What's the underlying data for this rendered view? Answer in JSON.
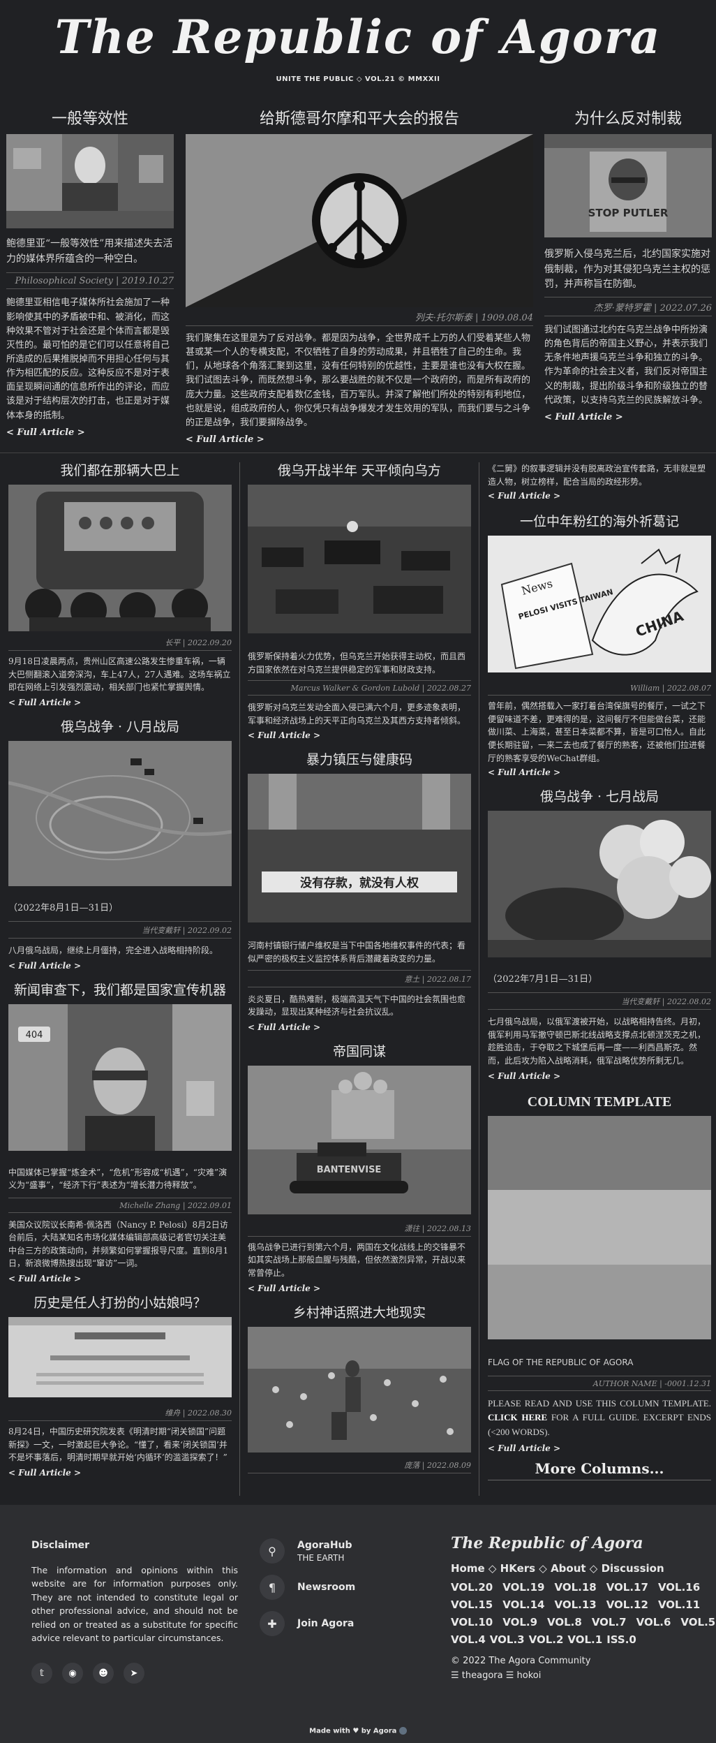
{
  "masthead": {
    "title": "The Republic of Agora",
    "issue_line": "UNITE THE PUBLIC ◇ VOL.21 © MMXXII"
  },
  "top_row": {
    "left": {
      "title": "一般等效性",
      "caption": "鲍德里亚“一般等效性”用来描述失去活力的媒体界所蕴含的一种空白。",
      "meta": "Philosophical Society | 2019.10.27",
      "body": "鲍德里亚相信电子媒体所社会施加了一种影响使其中的矛盾被中和、被消化，而这种效果不管对于社会还是个体而言都是毁灭性的。最可怕的是它们可以任意将自己所造成的后果推脱掉而不用担心任何与其作为相匹配的反应。这种反应不是对于表面呈现瞬间通的信息所作出的评论，而应该是对于结构层次的打击，也正是对于媒体本身的抵制。",
      "more": "Full Article"
    },
    "center": {
      "title": "给斯德哥尔摩和平大会的报告",
      "meta": "列夫·托尔斯泰 | 1909.08.04",
      "body": "我们聚集在这里是为了反对战争。都是因为战争，全世界成千上万的人们受着某些人物甚或某一个人的专横支配，不仅牺牲了自身的劳动成果，并且牺牲了自己的生命。我们，从地球各个角落汇聚到这里，没有任何特别的优越性，主要是谁也没有大权在握。我们试图去斗争，而既然想斗争，那么要战胜的就不仅是一个政府的，而是所有政府的庞大力量。这些政府支配着数亿金钱，百万军队。并深了解他们所处的特别有利地位，也就是说，组成政府的人，你仅凭只有战争爆发才发生效用的军队，而我们要与之斗争的正是战争，我们要摒除战争。",
      "more": "Full Article"
    },
    "right": {
      "title": "为什么反对制裁",
      "caption": "俄罗斯入侵乌克兰后，北约国家实施对俄制裁，作为对其侵犯乌克兰主权的惩罚，并声称旨在防御。",
      "meta": "杰罗·蒙特罗霍 | 2022.07.26",
      "body": "我们试图通过北约在乌克兰战争中所扮演的角色背后的帝国主义野心，并表示我们无条件地声援乌克兰斗争和独立的斗争。作为革命的社会主义者，我们反对帝国主义的制裁，提出阶级斗争和阶级独立的替代政策，以支持乌克兰的民族解放斗争。",
      "more": "Full Article"
    }
  },
  "col1": [
    {
      "title": "我们都在那辆大巴上",
      "meta": "长平 | 2022.09.20",
      "body": "9月18日凌晨两点，贵州山区高速公路发生惨重车祸，一辆大巴侧翻滚入道旁深沟，车上47人，27人遇难。这场车祸立即在网络上引发强烈震动，相关部门也紧忙掌握舆情。",
      "more": "Full Article"
    },
    {
      "title": "俄乌战争 · 八月战局",
      "caption": "（2022年8月1日—31日）",
      "meta": "当代变戴轩 | 2022.09.02",
      "body": "八月俄乌战局，继续上月僵持，完全进入战略相持阶段。",
      "more": "Full Article"
    },
    {
      "title": "新闻审查下，我们都是国家宣传机器",
      "caption": "中国媒体已掌握“炼金术”，“危机”形容成“机遇”，“灾难”演义为“盛事”，“经济下行”表述为“增长潜力待释放”。",
      "meta": "Michelle Zhang | 2022.09.01",
      "body": "美国众议院议长南希·佩洛西（Nancy P. Pelosi）8月2日访台前后，大陆某知名市场化媒体编辑部高级记者官切关注美中台三方的政策动向，并频繁如何掌握报导尺度。直到8月1日，新浪微博热搜出现“窜访”一词。",
      "more": "Full Article"
    },
    {
      "title": "历史是任人打扮的小姑娘吗？",
      "meta": "维舟 | 2022.08.30",
      "body": "8月24日，中国历史研究院发表《明清时期“闭关锁国”问题新探》一文，一时激起巨大争论。“懂了，看来‘闭关锁国’并不是坏事落后，明清时期早就开始‘内循环’的滥滥探索了！”",
      "more": "Full Article"
    }
  ],
  "col2": [
    {
      "title": "俄乌开战半年 天平倾向乌方",
      "caption": "俄罗斯保持着火力优势，但乌克兰开始获得主动权，而且西方国家依然在对乌克兰提供稳定的军事和财政支持。",
      "meta": "Marcus Walker & Gordon Lubold | 2022.08.27",
      "body": "俄罗斯对乌克兰发动全面入侵已满六个月，更多迹象表明，军事和经济战场上的天平正向乌克兰及其西方支持者倾斜。",
      "more": "Full Article"
    },
    {
      "title": "暴力镇压与健康码",
      "caption": "河南村镇银行储户维权是当下中国各地维权事件的代表；看似严密的极权主义监控体系背后潜藏着政变的力量。",
      "meta": "意土 | 2022.08.17",
      "body": "炎炎夏日，酷热难耐，极端高温天气下中国的社会氛围也愈发躁动，显现出某种经济与社会抗议乱。",
      "more": "Full Article"
    },
    {
      "title": "帝国同谋",
      "meta": "潇往 | 2022.08.13",
      "body": "俄乌战争已进行到第六个月，两国在文化战线上的交锋暴不如其实战场上那般血腥与残酷，但依然激烈异常，开战以来常曾停止。",
      "more": "Full Article"
    },
    {
      "title": "乡村神话照进大地现实",
      "meta": "庞落 | 2022.08.09"
    }
  ],
  "col3": [
    {
      "intro": "《二舅》的叙事逻辑并没有脱离政治宣传套路，无非就是塑造人物，树立榜样，配合当局的政经形势。",
      "more": "Full Article"
    },
    {
      "title": "一位中年粉红的海外祈葛记",
      "meta": "William | 2022.08.07",
      "body": "曾年前，偶然搭载入一家打着台湾保旗号的餐厅，一试之下便留味道不差，更难得的是，这间餐厅不但能做台菜，还能做川菜、上海菜，甚至日本菜都不算，皆是可口怡人。自此便长期驻留，一来二去也成了餐厅的熟客，还被他们拉进餐厅的熟客享受的WeChat群组。",
      "more": "Full Article",
      "cartoon_words": [
        "News",
        "PELOSI VISITS TAIWAN",
        "CHINA"
      ]
    },
    {
      "title": "俄乌战争 · 七月战局",
      "caption": "（2022年7月1日—31日）",
      "meta": "当代变戴轩 | 2022.08.02",
      "body": "七月俄乌战局，以俄军渡被开始，以战略相持告终。月初，俄军利用马军撤守顿巴斯北线战略支撑点北顿涅茨克之机，趁胜追击，于夺取之下城堡后再一度——利西昌斯克。然而，此后攻为陷入战略消耗，俄军战略优势所剩无几。",
      "more": "Full Article"
    },
    {
      "title": "COLUMN TEMPLATE",
      "caption": "FLAG OF THE REPUBLIC OF AGORA",
      "meta": "AUTHOR NAME | -0001.12.31",
      "body_pre": "PLEASE READ AND USE THIS COLUMN TEMPLATE. ",
      "body_link": "CLICK HERE",
      "body_post": " FOR A FULL GUIDE. EXCERPT ENDS (<200 WORDS).",
      "more": "Full Article",
      "more_columns": "More Columns..."
    }
  ],
  "image_text": {
    "sign_404": "404",
    "stop_putler": "STOP PUTLER",
    "banner": "没有存款，就没有人权",
    "tank": "BANTENVISE"
  },
  "footer": {
    "disclaimer_title": "Disclaimer",
    "disclaimer": "The information and opinions within this website are for information purposes only. They are not intended to constitute legal or other professional advice, and should not be relied on or treated as a substitute for specific advice relevant to particular circumstances.",
    "links": [
      {
        "label": "AgoraHub",
        "sub": "THE EARTH",
        "icon": "map-pin-icon"
      },
      {
        "label": "Newsroom",
        "sub": "",
        "icon": "paragraph-icon"
      },
      {
        "label": "Join Agora",
        "sub": "",
        "icon": "puzzle-icon"
      }
    ],
    "brand": "The Republic of Agora",
    "nav": [
      "Home",
      "HKers",
      "About",
      "Discussion"
    ],
    "volumes": [
      [
        "VOL.20",
        "VOL.19",
        "VOL.18",
        "VOL.17",
        "VOL.16"
      ],
      [
        "VOL.15",
        "VOL.14",
        "VOL.13",
        "VOL.12",
        "VOL.11"
      ],
      [
        "VOL.10",
        "VOL.9",
        "VOL.8",
        "VOL.7",
        "VOL.6",
        "VOL.5"
      ],
      [
        "VOL.4",
        "VOL.3",
        "VOL.2",
        "VOL.1",
        "ISS.0"
      ]
    ],
    "copyright": "© 2022 The Agora Community",
    "credits": "☰ theagora ☰ hokoi",
    "made_with": "Made with",
    "by": "by Agora"
  },
  "colors": {
    "background": "#202124",
    "footer": "#2d2e31",
    "text": "#d8d8d8"
  }
}
